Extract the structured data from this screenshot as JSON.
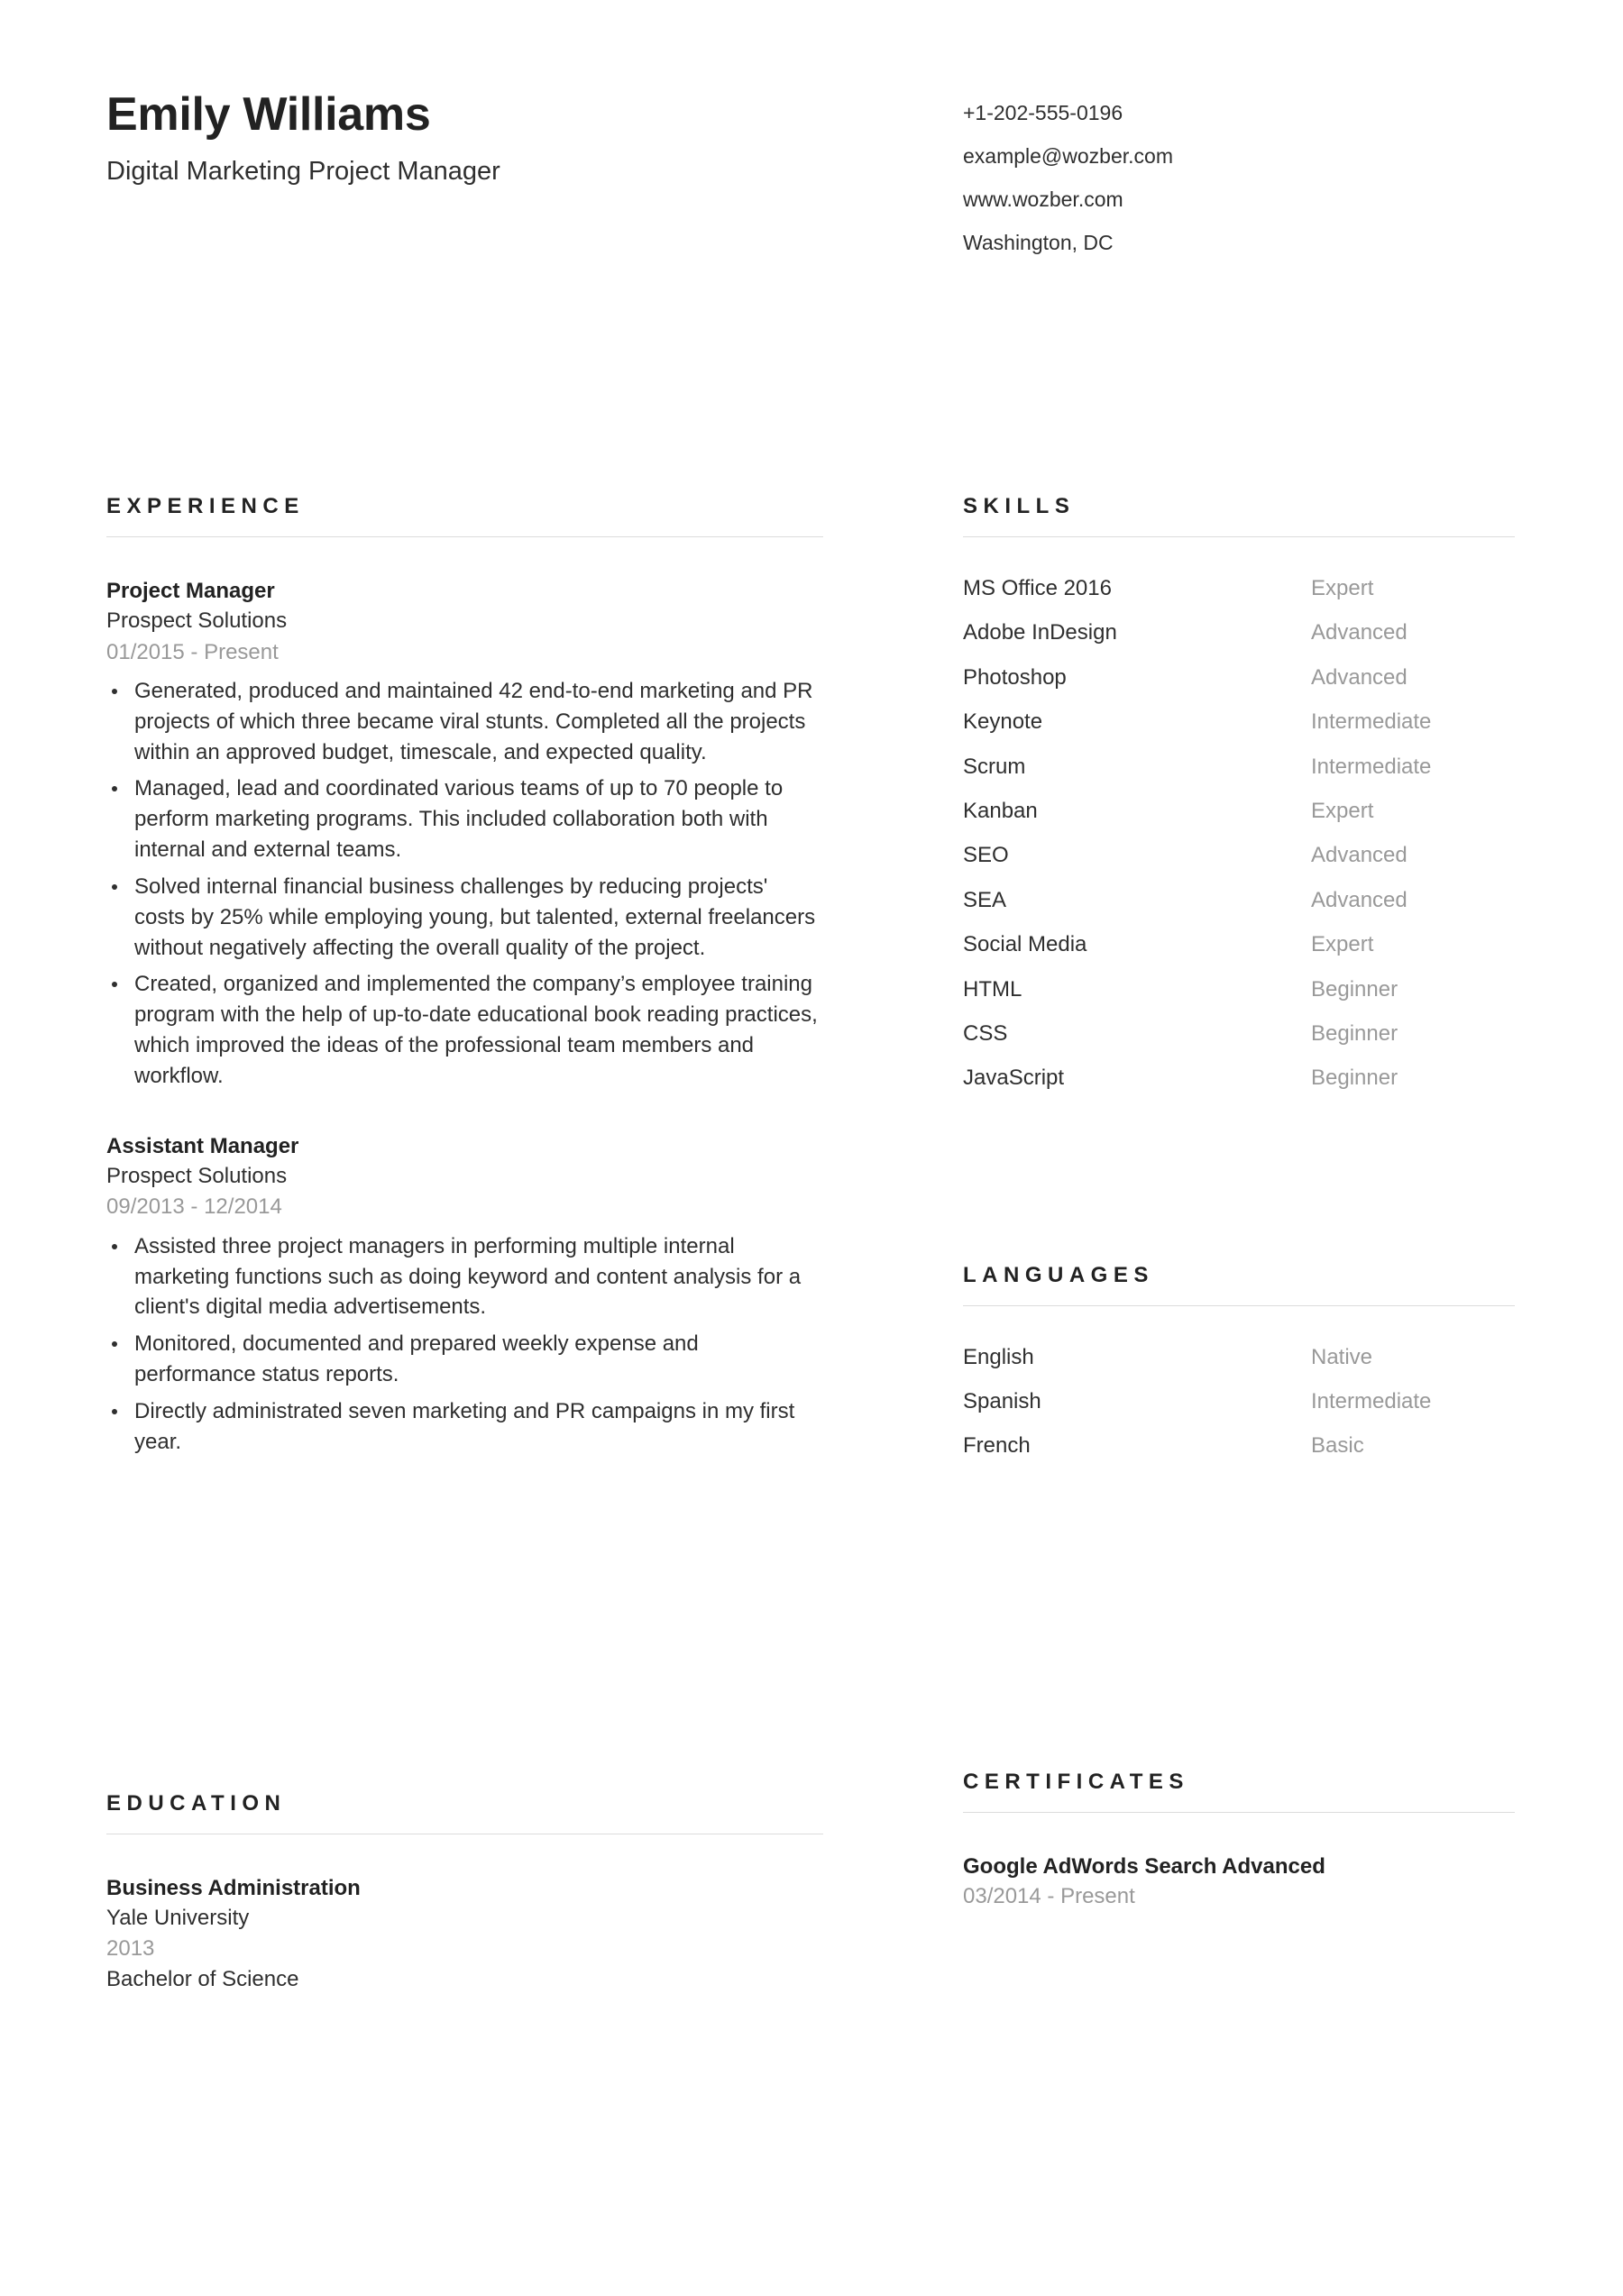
{
  "header": {
    "full_name": "Emily Williams",
    "job_title": "Digital Marketing Project Manager",
    "contact": {
      "phone": "+1-202-555-0196",
      "email": "example@wozber.com",
      "website": "www.wozber.com",
      "location": "Washington, DC"
    }
  },
  "sections": {
    "experience": {
      "title": "EXPERIENCE"
    },
    "skills": {
      "title": "SKILLS"
    },
    "languages": {
      "title": "LANGUAGES"
    },
    "education": {
      "title": "EDUCATION"
    },
    "certificates": {
      "title": "CERTIFICATES"
    }
  },
  "experience": [
    {
      "role": "Project Manager",
      "organization": "Prospect Solutions",
      "dates": "01/2015 - Present",
      "bullets": [
        "Generated, produced and maintained 42 end-to-end marketing and PR projects of which three became viral stunts. Completed all the projects within an approved budget, timescale, and expected quality.",
        "Managed, lead and coordinated various teams of up to 70 people to perform marketing programs. This included collaboration both with internal and external teams.",
        "Solved internal financial business challenges by reducing projects' costs by 25% while employing young, but talented, external freelancers without negatively affecting the overall quality of the project.",
        "Created, organized and implemented the company’s employee training program with the help of up-to-date educational book reading practices, which improved the ideas of the professional team members and workflow."
      ]
    },
    {
      "role": "Assistant Manager",
      "organization": "Prospect Solutions",
      "dates": "09/2013 - 12/2014",
      "bullets": [
        "Assisted three project managers in performing multiple internal marketing functions such as doing keyword and content analysis for a client's digital media advertisements.",
        "Monitored, documented and prepared weekly expense and performance status reports.",
        "Directly administrated seven marketing and PR campaigns in my first year."
      ]
    }
  ],
  "skills": [
    {
      "name": "MS Office 2016",
      "level": "Expert"
    },
    {
      "name": "Adobe InDesign",
      "level": "Advanced"
    },
    {
      "name": "Photoshop",
      "level": "Advanced"
    },
    {
      "name": "Keynote",
      "level": "Intermediate"
    },
    {
      "name": "Scrum",
      "level": "Intermediate"
    },
    {
      "name": "Kanban",
      "level": "Expert"
    },
    {
      "name": "SEO",
      "level": "Advanced"
    },
    {
      "name": "SEA",
      "level": "Advanced"
    },
    {
      "name": "Social Media",
      "level": "Expert"
    },
    {
      "name": "HTML",
      "level": "Beginner"
    },
    {
      "name": "CSS",
      "level": "Beginner"
    },
    {
      "name": "JavaScript",
      "level": "Beginner"
    }
  ],
  "languages": [
    {
      "name": "English",
      "level": "Native"
    },
    {
      "name": "Spanish",
      "level": "Intermediate"
    },
    {
      "name": "French",
      "level": "Basic"
    }
  ],
  "education": [
    {
      "degree": "Business Administration",
      "school": "Yale University",
      "year": "2013",
      "award": "Bachelor of Science"
    }
  ],
  "certificates": [
    {
      "name": "Google AdWords Search Advanced",
      "dates": "03/2014 - Present"
    }
  ],
  "colors": {
    "text_primary": "#2f2f2f",
    "text_heading": "#222222",
    "text_muted": "#999999",
    "rule": "#dcdcdc",
    "background": "#ffffff"
  }
}
